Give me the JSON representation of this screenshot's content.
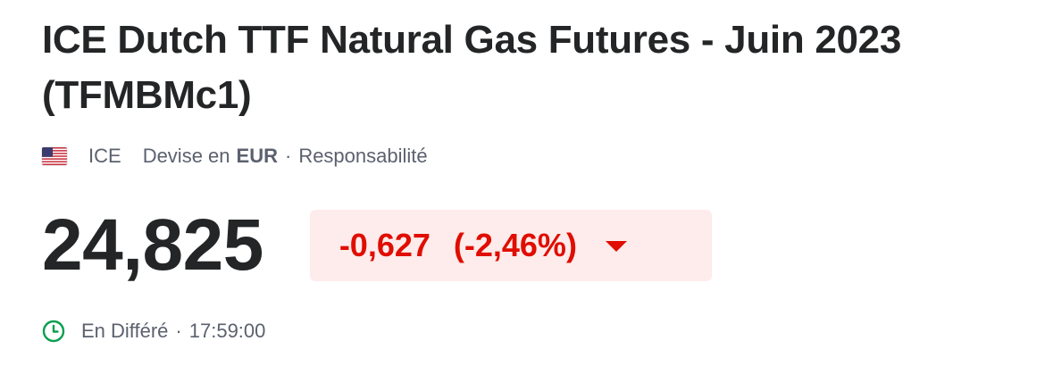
{
  "instrument": {
    "title": "ICE Dutch TTF Natural Gas Futures - Juin 2023 (TFMBMc1)"
  },
  "meta": {
    "flag_icon": "us-flag-icon",
    "exchange": "ICE",
    "currency_prefix": "Devise en",
    "currency": "EUR",
    "separator": "·",
    "disclaimer": "Responsabilité"
  },
  "quote": {
    "last_price": "24,825",
    "change": "-0,627",
    "change_percent": "(-2,46%)",
    "direction_icon": "triangle-down-icon",
    "change_color": "#e00d00",
    "change_bg": "#fdeceb"
  },
  "status": {
    "clock_icon": "clock-icon",
    "label": "En Différé",
    "separator": "·",
    "time": "17:59:00",
    "clock_color": "#0a9f4f"
  }
}
